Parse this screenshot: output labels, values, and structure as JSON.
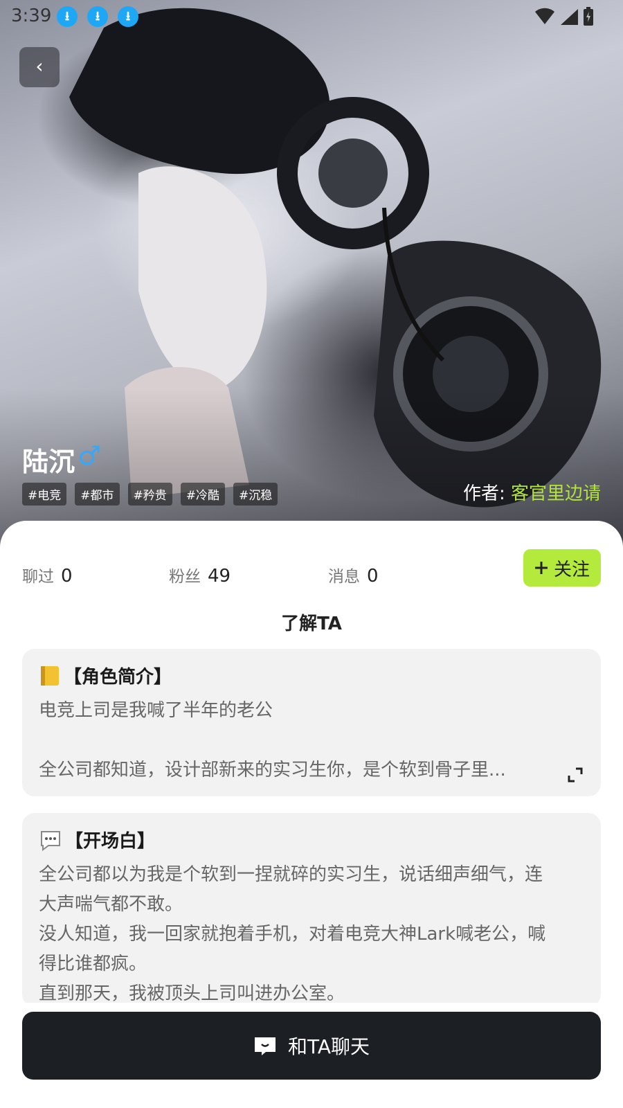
{
  "status_bar": {
    "time": "3:39"
  },
  "character": {
    "name": "陆沉",
    "gender_symbol": "♂",
    "tags": [
      "#电竞",
      "#都市",
      "#矜贵",
      "#冷酷",
      "#沉稳"
    ],
    "author_label": "作者:",
    "author_name": "客官里边请"
  },
  "stats": {
    "chatted_label": "聊过",
    "chatted_value": "0",
    "fans_label": "粉丝",
    "fans_value": "49",
    "messages_label": "消息",
    "messages_value": "0"
  },
  "follow_button": {
    "icon": "plus-icon",
    "label": "关注"
  },
  "section_title": "了解TA",
  "intro_card": {
    "icon": "notebook-emoji",
    "title": "【角色简介】",
    "line1": "电竞上司是我喊了半年的老公",
    "line2": "全公司都知道，设计部新来的实习生你，是个软到骨子里..."
  },
  "opening_card": {
    "icon": "speech-bubble-emoji",
    "title": "【开场白】",
    "line1": "全公司都以为我是个软到一捏就碎的实习生，说话细声细气，连",
    "line2": "大声喘气都不敢。",
    "line3": "没人知道，我一回家就抱着手机，对着电竞大神Lark喊老公，喊",
    "line4": "得比谁都疯。",
    "line5": "直到那天，我被顶头上司叫进办公室。"
  },
  "chat_button": {
    "icon": "chat-icon",
    "label": "和TA聊天"
  },
  "colors": {
    "accent_green": "#b4ea3c",
    "author_green": "#b2e43c",
    "chat_button_bg": "#1c1f24",
    "gender_blue": "#3aa6f4"
  }
}
